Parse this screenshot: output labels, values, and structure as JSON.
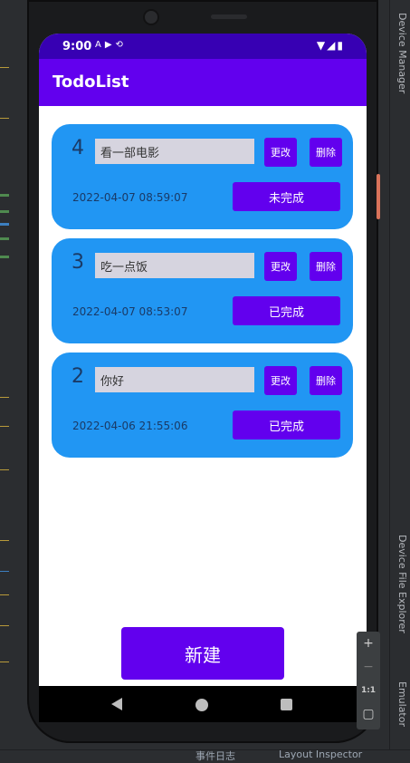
{
  "status_bar": {
    "time": "9:00",
    "left_icons": [
      "notification-a-icon",
      "youtube-icon",
      "sync-icon"
    ],
    "right_icons": [
      "wifi-icon",
      "signal-icon",
      "battery-icon"
    ]
  },
  "app_bar": {
    "title": "TodoList"
  },
  "todos": [
    {
      "number": "4",
      "content": "看一部电影",
      "edit_label": "更改",
      "delete_label": "删除",
      "date": "2022-04-07 08:59:07",
      "status_label": "未完成"
    },
    {
      "number": "3",
      "content": "吃一点饭",
      "edit_label": "更改",
      "delete_label": "删除",
      "date": "2022-04-07 08:53:07",
      "status_label": "已完成"
    },
    {
      "number": "2",
      "content": "你好",
      "edit_label": "更改",
      "delete_label": "删除",
      "date": "2022-04-06 21:55:06",
      "status_label": "已完成"
    }
  ],
  "new_button_label": "新建",
  "ide": {
    "right_panel_top": "Device Manager",
    "right_panel_bottom": "Device File Explorer",
    "right_panel_emulator": "Emulator",
    "zoom_in": "+",
    "zoom_out": "−",
    "zoom_ratio": "1:1",
    "bottom_left": "事件日志",
    "bottom_right": "Layout Inspector"
  },
  "colors": {
    "primary": "#6200ee",
    "primary_dark": "#3700b3",
    "card": "#2196f3",
    "input_bg": "#d6d4df"
  }
}
